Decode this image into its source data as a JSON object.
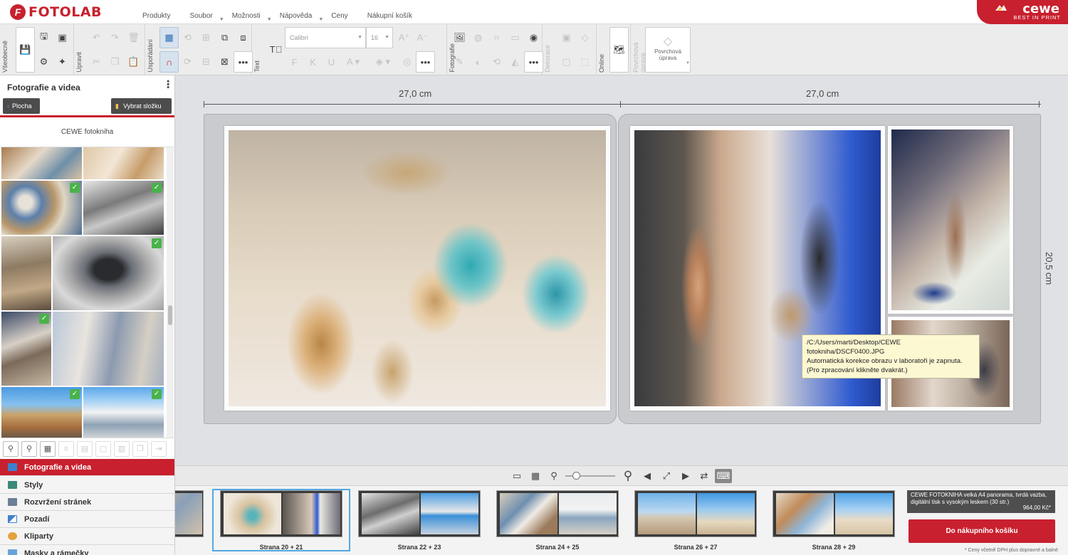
{
  "app": {
    "logo_mark": "F",
    "logo_text": "FOTOLAB",
    "brand": "cewe",
    "brand_tag": "BEST IN PRINT"
  },
  "menu": [
    "Produkty",
    "Soubor",
    "Možnosti",
    "Nápověda",
    "Ceny",
    "Nákupní košík"
  ],
  "toolbar": {
    "groups": [
      "Všeobecně",
      "Upravit",
      "Uspořádání",
      "Text",
      "Fotografie",
      "Dekorace",
      "Online",
      "Povrchová úprava"
    ],
    "font_name": "Calibri",
    "font_size": "16",
    "surface_label": "Povrchová úprava"
  },
  "left_panel": {
    "title": "Fotografie a videa",
    "back_button": "Plocha",
    "folder_button": "Vybrat složku",
    "folder_name": "CEWE fotokniha",
    "sections": [
      "Fotografie a videa",
      "Styly",
      "Rozvržení stránek",
      "Pozadí",
      "Kliparty",
      "Masky a rámečky"
    ]
  },
  "canvas": {
    "width_left": "27,0 cm",
    "width_right": "27,0 cm",
    "height": "20,5 cm",
    "tooltip": {
      "path": "/C:/Users/marti/Desktop/CEWE fotokniha/DSCF0400.JPG",
      "line2": "Automatická korekce obrazu v laboratoři je zapnuta.",
      "line3": "(Pro zpracování klikněte dvakrát.)"
    }
  },
  "filmstrip": {
    "spreads": [
      "Strana 20 + 21",
      "Strana 22 + 23",
      "Strana 24 + 25",
      "Strana 26 + 27",
      "Strana 28 + 29"
    ],
    "selected": "Strana 20 + 21"
  },
  "order": {
    "product_desc": "CEWE FOTOKNIHA velká A4 panorama, tvrdá vazba, digitální tisk s vysokým leskem (30 str.)",
    "price": "964,00 Kč*",
    "cart_button": "Do nákupního košíku",
    "note": "* Ceny včetně DPH plus dopravné a balné"
  },
  "colors": {
    "accent": "#c8202e",
    "selection": "#55a7e0",
    "check": "#4ab24a"
  }
}
